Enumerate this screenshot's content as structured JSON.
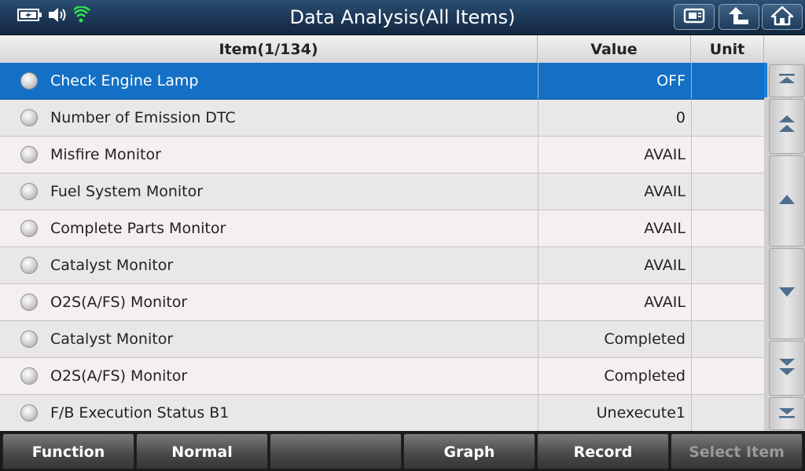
{
  "header": {
    "title": "Data Analysis(All Items)",
    "buttons": [
      "screenshot-icon",
      "back-up-icon",
      "home-icon"
    ],
    "status_icons": [
      "battery-charging-icon",
      "volume-icon",
      "wifi-icon"
    ]
  },
  "table": {
    "headers": {
      "item": "Item(1/134)",
      "value": "Value",
      "unit": "Unit"
    },
    "rows": [
      {
        "item": "Check Engine Lamp",
        "value": "OFF",
        "unit": "",
        "selected": true
      },
      {
        "item": "Number of Emission DTC",
        "value": "0",
        "unit": ""
      },
      {
        "item": "Misfire Monitor",
        "value": "AVAIL",
        "unit": ""
      },
      {
        "item": "Fuel System Monitor",
        "value": "AVAIL",
        "unit": ""
      },
      {
        "item": "Complete Parts Monitor",
        "value": "AVAIL",
        "unit": ""
      },
      {
        "item": "Catalyst Monitor",
        "value": "AVAIL",
        "unit": ""
      },
      {
        "item": "O2S(A/FS) Monitor",
        "value": "AVAIL",
        "unit": ""
      },
      {
        "item": "Catalyst Monitor",
        "value": "Completed",
        "unit": ""
      },
      {
        "item": "O2S(A/FS) Monitor",
        "value": "Completed",
        "unit": ""
      },
      {
        "item": "F/B Execution Status B1",
        "value": "Unexecute1",
        "unit": ""
      }
    ]
  },
  "scrollbar": {
    "buttons": [
      "scroll-top-icon",
      "page-up-icon",
      "line-up-icon",
      "line-down-icon",
      "page-down-icon",
      "scroll-bottom-icon"
    ]
  },
  "toolbar": {
    "function": "Function",
    "normal": "Normal",
    "empty": "",
    "graph": "Graph",
    "record": "Record",
    "select_item": "Select Item"
  },
  "colors": {
    "header_bg": "#1b3553",
    "selected_row": "#1370c5",
    "accent_green": "#2ee64a"
  }
}
